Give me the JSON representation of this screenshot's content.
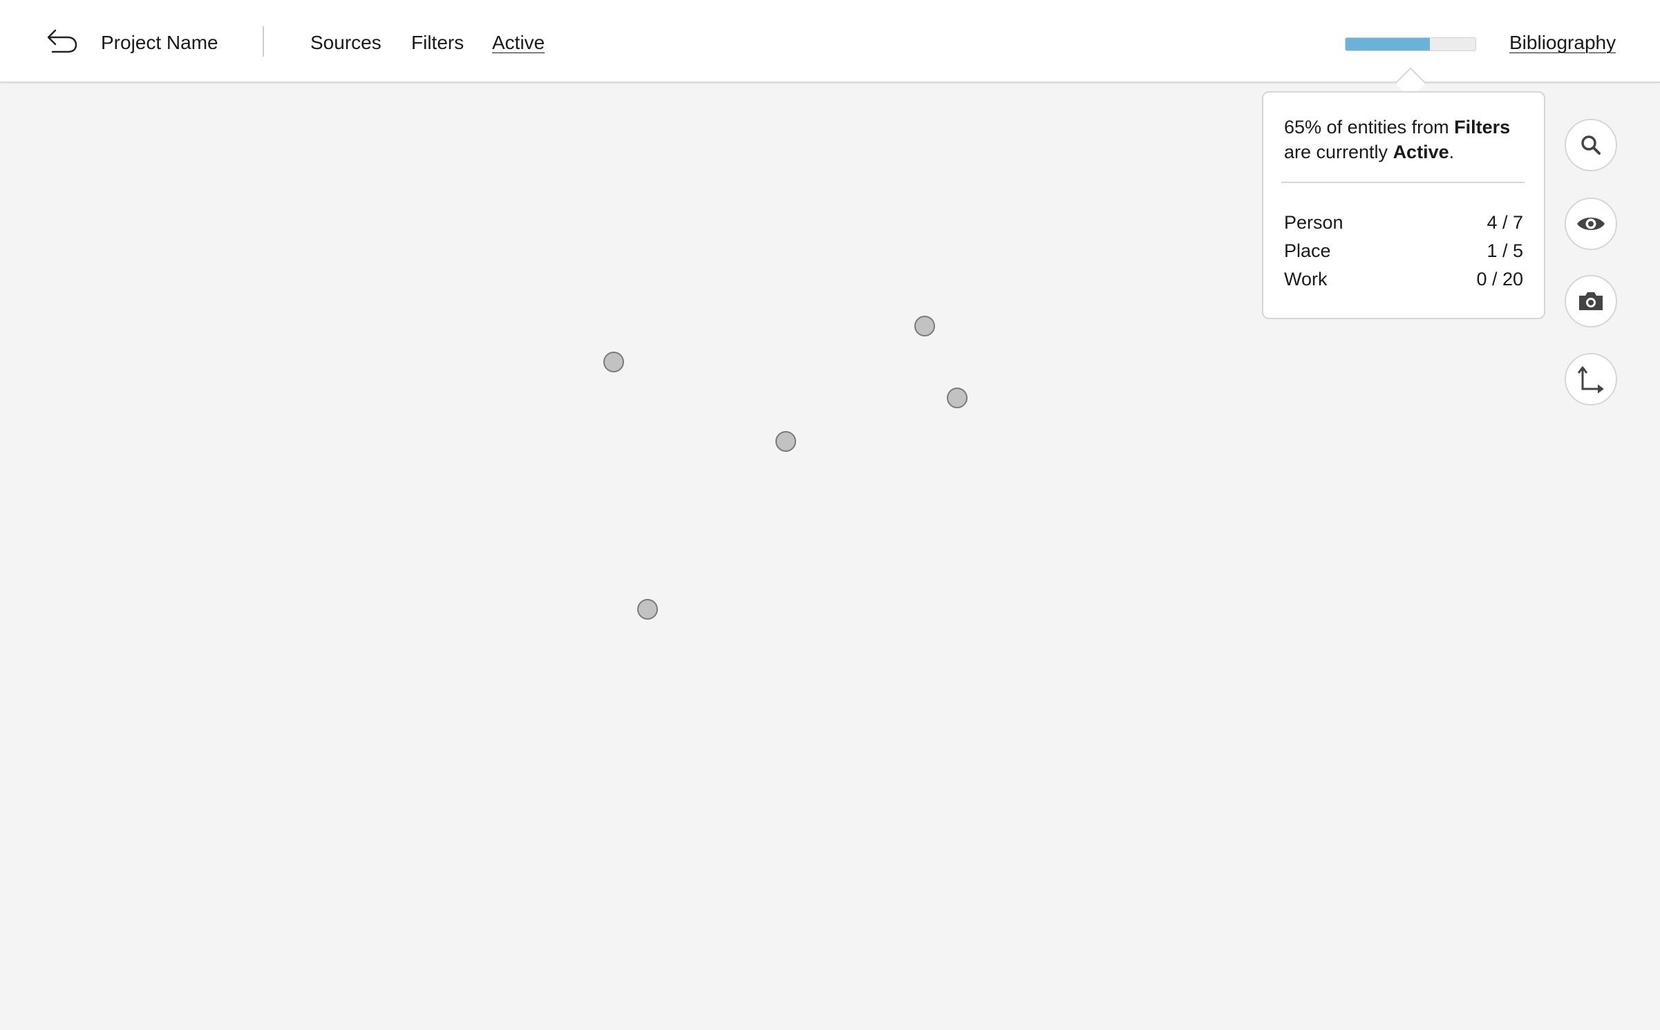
{
  "header": {
    "back_icon": "undo-arrow-icon",
    "project_name": "Project Name",
    "nav": [
      {
        "label": "Sources",
        "active": false
      },
      {
        "label": "Filters",
        "active": false
      },
      {
        "label": "Active",
        "active": true
      }
    ],
    "progress_fraction": 0.65,
    "progress_color": "#6bb2d8",
    "bibliography_label": "Bibliography"
  },
  "popover": {
    "percent": "65%",
    "text_1": " of entities from ",
    "source": "Filters",
    "text_2": "are currently ",
    "target": "Active",
    "text_3": ".",
    "stats": [
      {
        "label": "Person",
        "value": "4 / 7"
      },
      {
        "label": "Place",
        "value": "1 / 5"
      },
      {
        "label": "Work",
        "value": "0 / 20"
      }
    ]
  },
  "tools": [
    {
      "name": "search",
      "icon": "search-icon"
    },
    {
      "name": "visibility",
      "icon": "eye-icon"
    },
    {
      "name": "snapshot",
      "icon": "camera-icon"
    },
    {
      "name": "axes",
      "icon": "axes-icon"
    }
  ],
  "colors": {
    "background": "#f4f4f4",
    "node_fill": "#c2c2c2",
    "node_stroke": "#7a7a7a"
  }
}
